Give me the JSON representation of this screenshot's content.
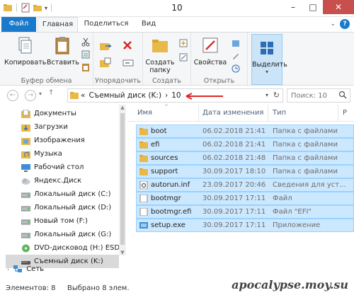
{
  "window": {
    "title": "10"
  },
  "ribbon_tabs": {
    "file": "Файл",
    "home": "Главная",
    "share": "Поделиться",
    "view": "Вид"
  },
  "ribbon": {
    "copy": "Копировать",
    "paste": "Вставить",
    "clipboard_group": "Буфер обмена",
    "organize_group": "Упорядочить",
    "new_folder": "Создать папку",
    "create_group": "Создать",
    "properties": "Свойства",
    "open_group": "Открыть",
    "select": "Выделить"
  },
  "address": {
    "prefix": "«",
    "crumb_drive": "Съемный диск (K:)",
    "separator": "›",
    "crumb_folder": "10"
  },
  "search": {
    "placeholder": "Поиск: 10"
  },
  "nav": {
    "items": [
      {
        "label": "Документы",
        "icon": "documents-icon"
      },
      {
        "label": "Загрузки",
        "icon": "downloads-icon"
      },
      {
        "label": "Изображения",
        "icon": "pictures-icon"
      },
      {
        "label": "Музыка",
        "icon": "music-icon"
      },
      {
        "label": "Рабочий стол",
        "icon": "desktop-icon"
      },
      {
        "label": "Яндекс.Диск",
        "icon": "yandex-disk-icon"
      },
      {
        "label": "Локальный диск (C:)",
        "icon": "drive-icon"
      },
      {
        "label": "Локальный диск (D:)",
        "icon": "drive-icon"
      },
      {
        "label": "Новый том (F:)",
        "icon": "drive-icon"
      },
      {
        "label": "Локальный диск (G:)",
        "icon": "drive-icon"
      },
      {
        "label": "DVD-дисковод (H:) ESD-ISO",
        "icon": "dvd-icon"
      },
      {
        "label": "Съемный диск (K:)",
        "icon": "usb-drive-icon"
      }
    ],
    "network": "Сеть"
  },
  "columns": {
    "name": "Имя",
    "date": "Дата изменения",
    "type": "Тип",
    "size": "Р"
  },
  "files": [
    {
      "name": "boot",
      "date": "06.02.2018 21:41",
      "type": "Папка с файлами",
      "icon": "folder-icon"
    },
    {
      "name": "efi",
      "date": "06.02.2018 21:41",
      "type": "Папка с файлами",
      "icon": "folder-icon"
    },
    {
      "name": "sources",
      "date": "06.02.2018 21:48",
      "type": "Папка с файлами",
      "icon": "folder-icon"
    },
    {
      "name": "support",
      "date": "30.09.2017 18:10",
      "type": "Папка с файлами",
      "icon": "folder-icon"
    },
    {
      "name": "autorun.inf",
      "date": "23.09.2017 20:46",
      "type": "Сведения для уст...",
      "icon": "settings-file-icon"
    },
    {
      "name": "bootmgr",
      "date": "30.09.2017 17:11",
      "type": "Файл",
      "icon": "file-icon"
    },
    {
      "name": "bootmgr.efi",
      "date": "30.09.2017 17:11",
      "type": "Файл \"EFI\"",
      "icon": "file-icon"
    },
    {
      "name": "setup.exe",
      "date": "30.09.2017 17:11",
      "type": "Приложение",
      "icon": "setup-icon"
    }
  ],
  "status": {
    "count": "Элементов: 8",
    "selected": "Выбрано 8 элем.",
    "watermark": "apocalypse.moy.su"
  },
  "colors": {
    "accent": "#1979ca",
    "selection": "#cce8ff",
    "close": "#c7504f",
    "arrow": "#e0252a"
  }
}
